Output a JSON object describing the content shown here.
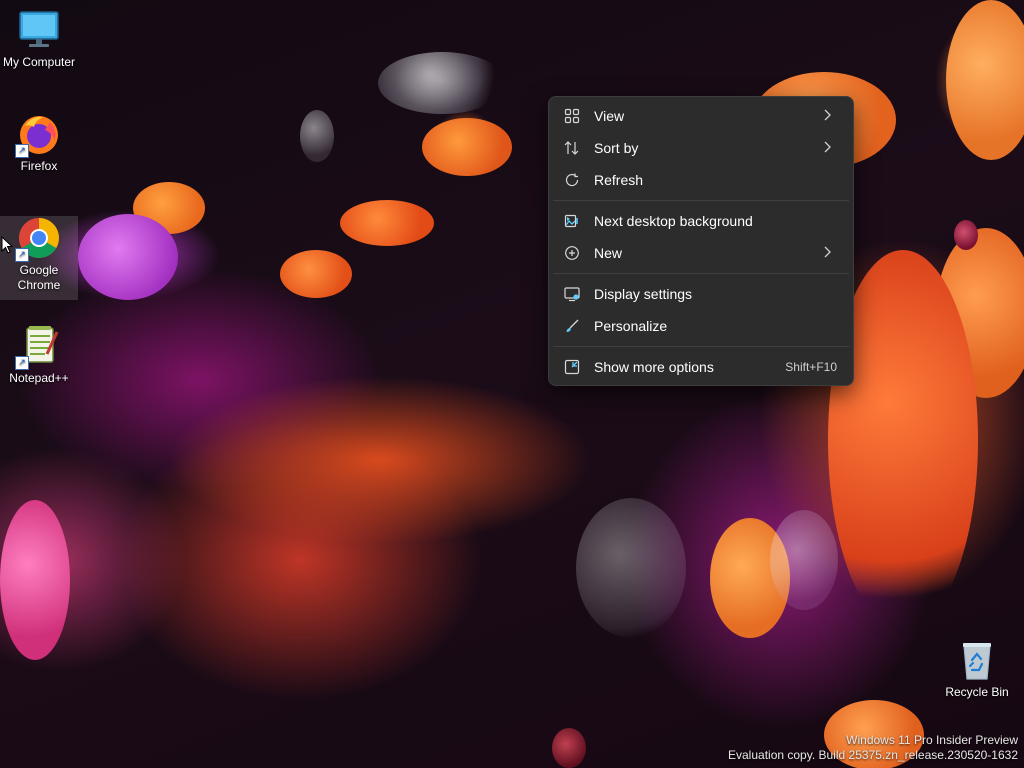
{
  "desktop_icons": [
    {
      "label": "My Computer",
      "icon": "monitor-icon"
    },
    {
      "label": "Firefox",
      "icon": "firefox-icon"
    },
    {
      "label": "Google Chrome",
      "icon": "chrome-icon"
    },
    {
      "label": "Notepad++",
      "icon": "notepadpp-icon"
    },
    {
      "label": "Recycle Bin",
      "icon": "recycle-bin-icon"
    }
  ],
  "context_menu": {
    "items": [
      {
        "label": "View",
        "icon": "grid-icon",
        "submenu": true
      },
      {
        "label": "Sort by",
        "icon": "sort-icon",
        "submenu": true
      },
      {
        "label": "Refresh",
        "icon": "refresh-icon",
        "submenu": false
      },
      {
        "label": "Next desktop background",
        "icon": "next-background-icon",
        "submenu": false
      },
      {
        "label": "New",
        "icon": "new-icon",
        "submenu": true
      },
      {
        "label": "Display settings",
        "icon": "display-icon",
        "submenu": false
      },
      {
        "label": "Personalize",
        "icon": "brush-icon",
        "submenu": false
      },
      {
        "label": "Show more options",
        "icon": "more-options-icon",
        "submenu": false,
        "shortcut": "Shift+F10"
      }
    ]
  },
  "watermark": {
    "line1": "Windows 11 Pro Insider Preview",
    "line2": "Evaluation copy. Build 25375.zn_release.230520-1632"
  },
  "colors": {
    "menu_bg": "#2c2c2c",
    "menu_text": "#ffffff",
    "accent": "#60cdff"
  }
}
